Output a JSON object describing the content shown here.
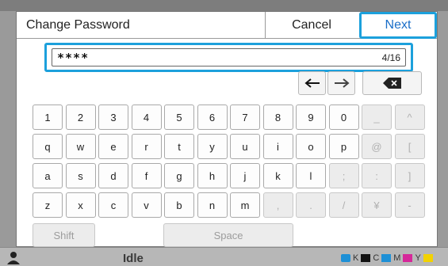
{
  "dialog": {
    "title": "Change Password",
    "cancel_label": "Cancel",
    "next_label": "Next"
  },
  "password": {
    "value": "****",
    "counter": "4/16"
  },
  "nav": {
    "left_arrow": "←",
    "right_arrow": "→",
    "delete_icon": "backspace-icon"
  },
  "keyboard": {
    "rows": [
      [
        "1",
        "2",
        "3",
        "4",
        "5",
        "6",
        "7",
        "8",
        "9",
        "0",
        "_",
        "^"
      ],
      [
        "q",
        "w",
        "e",
        "r",
        "t",
        "y",
        "u",
        "i",
        "o",
        "p",
        "@",
        "["
      ],
      [
        "a",
        "s",
        "d",
        "f",
        "g",
        "h",
        "j",
        "k",
        "l",
        ";",
        ":",
        "]"
      ],
      [
        "z",
        "x",
        "c",
        "v",
        "b",
        "n",
        "m",
        ",",
        ".",
        "/",
        "¥",
        "-"
      ]
    ],
    "shift_label": "Shift",
    "space_label": "Space"
  },
  "underlay": {
    "status_text": "Idle",
    "toner_labels": [
      "K",
      "C",
      "M",
      "Y"
    ],
    "toner_colors": [
      "#111111",
      "#1e90d6",
      "#d6289a",
      "#f2d200"
    ]
  },
  "colors": {
    "accent": "#1ca0dc",
    "next_text": "#1a6ec8"
  }
}
